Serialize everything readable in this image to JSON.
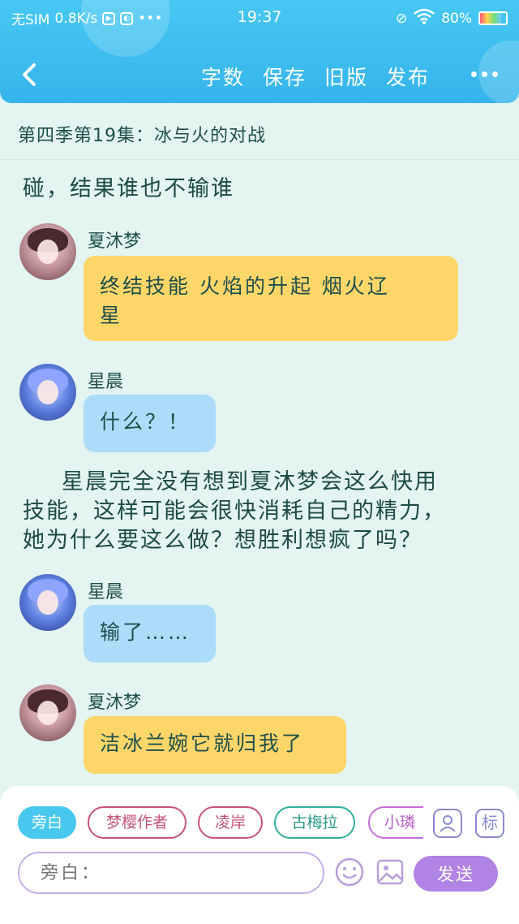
{
  "status_bar": {
    "carrier": "无SIM",
    "speed": "0.8K/s",
    "time": "19:37",
    "battery": "80%",
    "battery_level": 0.8
  },
  "nav": {
    "actions": [
      "字数",
      "保存",
      "旧版",
      "发布"
    ]
  },
  "chapter_title": "第四季第19集：冰与火的对战",
  "content": {
    "narration_top": "碰，结果谁也不输谁",
    "messages": [
      {
        "speaker": "夏沐梦",
        "text_lines": [
          "终结技能 火焰的升起 烟火辽",
          "星"
        ],
        "color": "yellow",
        "avatar": "pink"
      },
      {
        "speaker": "星晨",
        "text_lines": [
          "什么？！"
        ],
        "color": "blue",
        "avatar": "blue"
      }
    ],
    "narration_mid": [
      "星晨完全没有想到夏沐梦会这么快用",
      "技能，这样可能会很快消耗自己的精力，",
      "她为什么要这么做？想胜利想疯了吗？"
    ],
    "messages2": [
      {
        "speaker": "星晨",
        "text": "输了……",
        "color": "blue",
        "avatar": "blue"
      },
      {
        "speaker": "夏沐梦",
        "text": "洁冰兰婉它就归我了",
        "color": "yellow",
        "avatar": "pink"
      }
    ]
  },
  "bottom": {
    "roles": [
      "旁白",
      "梦樱作者",
      "凌岸",
      "古梅拉",
      "小璘"
    ],
    "tool_label": "标",
    "input_placeholder": "旁白：",
    "send_label": "发送"
  },
  "colors": {
    "header": "#3bbcef",
    "background": "#e3f4f1",
    "yellow_bubble": "#fdd66a",
    "blue_bubble": "#acdcf9",
    "send_button": "#b083e4"
  }
}
